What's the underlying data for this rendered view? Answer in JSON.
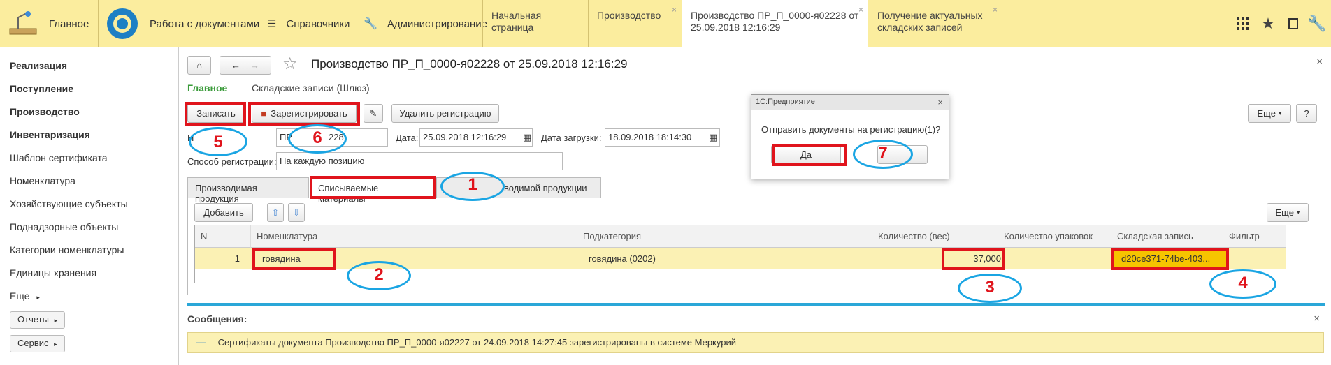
{
  "topbar": {
    "home_label": "Главное",
    "docs_label": "Работа с документами",
    "refs_label": "Справочники",
    "admin_label": "Администрирование",
    "tabs": [
      {
        "label": "Начальная страница"
      },
      {
        "label": "Производство"
      },
      {
        "label": "Производство ПР_П_0000-я02228 от 25.09.2018 12:16:29"
      },
      {
        "label": "Получение актуальных складских записей"
      }
    ]
  },
  "sidebar": {
    "items": [
      {
        "label": "Реализация"
      },
      {
        "label": "Поступление"
      },
      {
        "label": "Производство"
      },
      {
        "label": "Инвентаризация"
      },
      {
        "label": "Шаблон сертификата"
      },
      {
        "label": "Номенклатура"
      },
      {
        "label": "Хозяйствующие субъекты"
      },
      {
        "label": "Поднадзорные объекты"
      },
      {
        "label": "Категории номенклатуры"
      },
      {
        "label": "Единицы хранения"
      },
      {
        "label": "Еще"
      }
    ],
    "reports_label": "Отчеты",
    "service_label": "Сервис"
  },
  "doc": {
    "title": "Производство ПР_П_0000-я02228 от 25.09.2018 12:16:29",
    "nav_main": "Главное",
    "nav_gateway": "Складские записи (Шлюз)",
    "btn_save": "Записать",
    "btn_register": "Зарегистрировать",
    "btn_delete_reg": "Удалить регистрацию",
    "btn_more": "Еще",
    "btn_help": "?",
    "number_partial": "ПР",
    "number_tail": "228",
    "date_label": "Дата:",
    "date_value": "25.09.2018 12:16:29",
    "load_date_label": "Дата загрузки:",
    "load_date_value": "18.09.2018 18:14:30",
    "reg_method_label": "Способ регистрации:",
    "reg_method_value": "На каждую позицию"
  },
  "form_tabs": [
    {
      "label": "Производимая продукция"
    },
    {
      "label": "Списываемые материалы"
    },
    {
      "label": "водимой продукции"
    }
  ],
  "table_toolbar": {
    "add_label": "Добавить",
    "more_label": "Еще"
  },
  "table": {
    "columns": [
      "N",
      "Номенклатура",
      "Подкатегория",
      "Количество (вес)",
      "Количество упаковок",
      "Складская запись",
      "Фильтр"
    ],
    "rows": [
      {
        "n": "1",
        "nomenclature": "говядина",
        "subcategory": "говядина (0202)",
        "qty_weight": "37,000",
        "qty_packs": "",
        "stock_record": "d20ce371-74be-403...",
        "filter": ""
      }
    ]
  },
  "dialog": {
    "title": "1С:Предприятие",
    "question": "Отправить документы на регистрацию(1)?",
    "yes_label": "Да"
  },
  "messages": {
    "header": "Сообщения:",
    "text": "Сертификаты документа Производство ПР_П_0000-я02227 от 24.09.2018 14:27:45 зарегистрированы в системе Меркурий"
  },
  "annotations": [
    "1",
    "2",
    "3",
    "4",
    "5",
    "6",
    "7"
  ],
  "colors": {
    "topbar": "#fbed9e",
    "accent_green": "#3a9b3a",
    "highlight_red": "#e0141c",
    "ellipse_blue": "#1aa5e3",
    "row_highlight": "#fbf1b4",
    "stock_record_bg": "#f6c400"
  }
}
